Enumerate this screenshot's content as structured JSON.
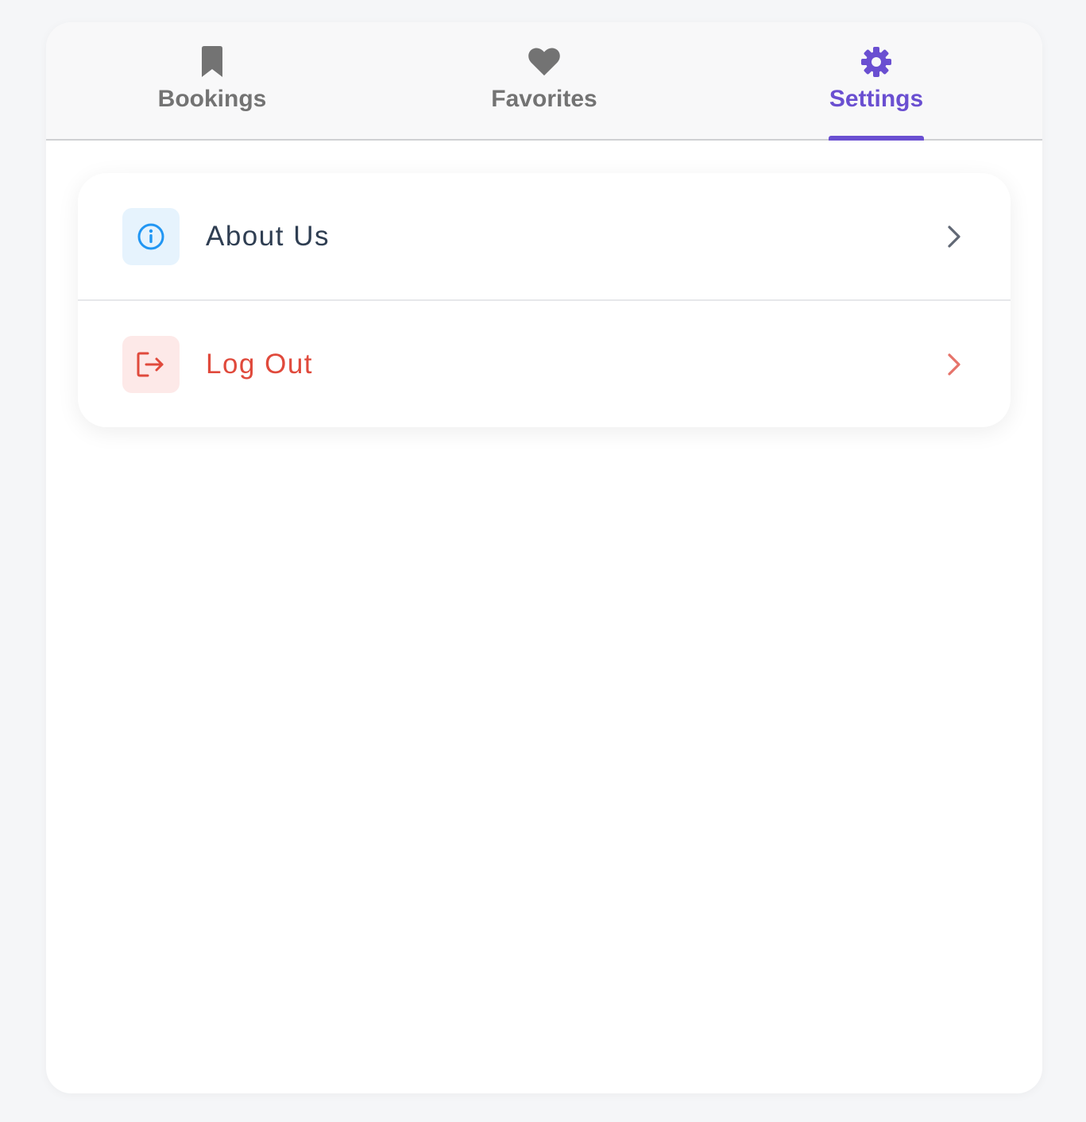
{
  "tabs": [
    {
      "label": "Bookings",
      "icon": "bookmark-icon",
      "active": false
    },
    {
      "label": "Favorites",
      "icon": "heart-icon",
      "active": false
    },
    {
      "label": "Settings",
      "icon": "gear-icon",
      "active": true
    }
  ],
  "settings": {
    "about": {
      "label": "About Us",
      "icon": "info-icon"
    },
    "logout": {
      "label": "Log Out",
      "icon": "logout-icon"
    }
  },
  "colors": {
    "accent": "#6a4fd1",
    "inactive_tab": "#737373",
    "info_blue": "#2196f3",
    "danger_red": "#e04a3c"
  }
}
